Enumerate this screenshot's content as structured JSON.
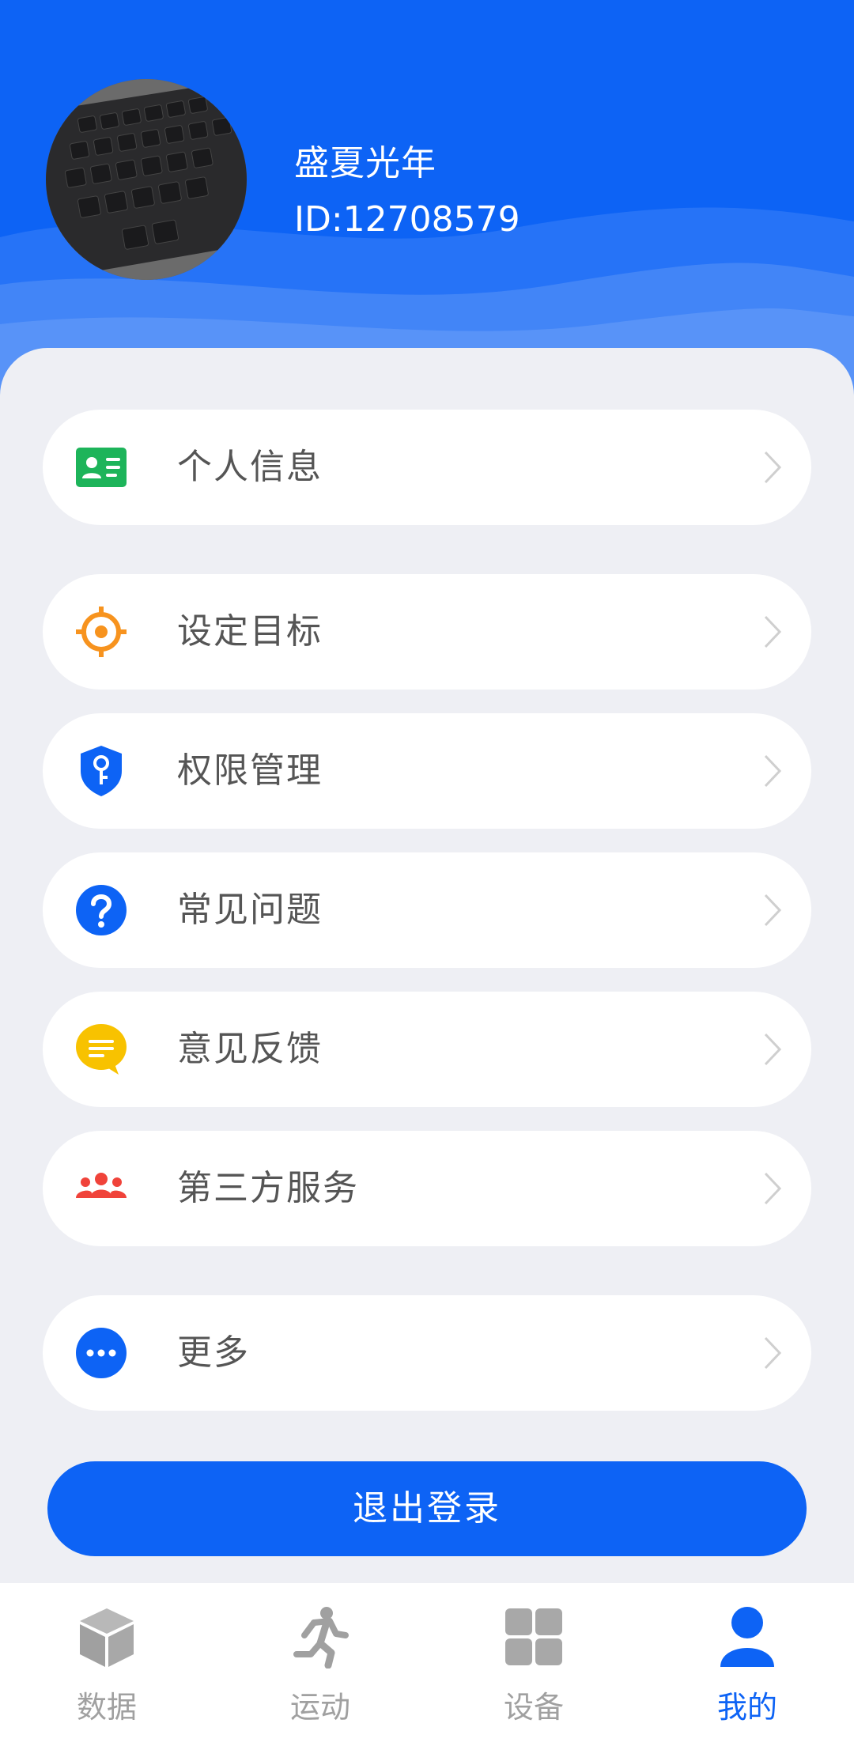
{
  "profile": {
    "username": "盛夏光年",
    "user_id": "ID:12708579"
  },
  "menu": {
    "items": [
      {
        "label": "个人信息",
        "icon": "id-card-icon",
        "color": "#1db45a"
      },
      {
        "label": "设定目标",
        "icon": "target-icon",
        "color": "#f7931e"
      },
      {
        "label": "权限管理",
        "icon": "shield-key-icon",
        "color": "#0d63f5"
      },
      {
        "label": "常见问题",
        "icon": "question-icon",
        "color": "#0d63f5"
      },
      {
        "label": "意见反馈",
        "icon": "feedback-icon",
        "color": "#f8c200"
      },
      {
        "label": "第三方服务",
        "icon": "group-icon",
        "color": "#f0433a"
      },
      {
        "label": "更多",
        "icon": "more-icon",
        "color": "#0d63f5"
      }
    ]
  },
  "logout_label": "退出登录",
  "tabs": [
    {
      "label": "数据",
      "icon": "cube-icon",
      "active": false
    },
    {
      "label": "运动",
      "icon": "running-icon",
      "active": false
    },
    {
      "label": "设备",
      "icon": "grid-icon",
      "active": false
    },
    {
      "label": "我的",
      "icon": "person-icon",
      "active": true
    }
  ],
  "colors": {
    "primary": "#0d63f5",
    "inactive": "#a0a0a0",
    "background": "#eeeff4"
  }
}
